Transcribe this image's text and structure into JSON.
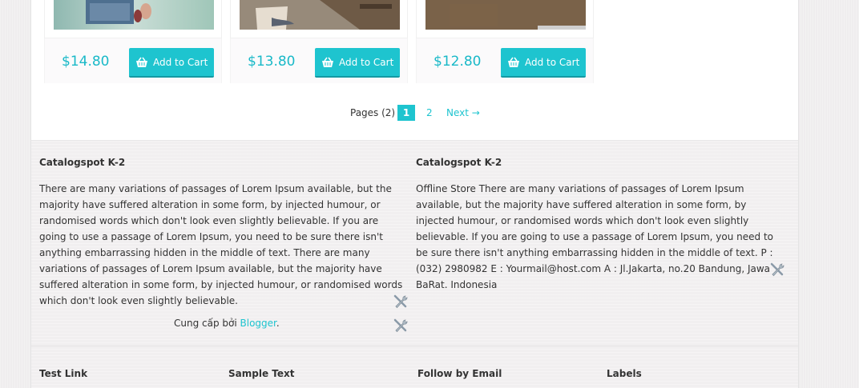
{
  "products": [
    {
      "price": "$14.80",
      "button_label": "Add to Cart"
    },
    {
      "price": "$13.80",
      "button_label": "Add to Cart"
    },
    {
      "price": "$12.80",
      "button_label": "Add to Cart"
    }
  ],
  "pagination": {
    "label": "Pages (2)",
    "current": "1",
    "page2": "2",
    "next": "Next →"
  },
  "footer": {
    "left": {
      "title": "Catalogspot K-2",
      "text": "There are many variations of passages of Lorem Ipsum available, but the majority have suffered alteration in some form, by injected humour, or randomised words which don't look even slightly believable. If you are going to use a passage of Lorem Ipsum, you need to be sure there isn't anything embarrassing hidden in the middle of text. There are many variations of passages of Lorem Ipsum available, but the majority have suffered alteration in some form, by injected humour, or randomised words which don't look even slightly believable."
    },
    "right": {
      "title": "Catalogspot K-2",
      "text": "Offline Store There are many variations of passages of Lorem Ipsum available, but the majority have suffered alteration in some form, by injected humour, or randomised words which don't look even slightly believable. If you are going to use a passage of Lorem Ipsum, you need to be sure there isn't anything embarrassing hidden in the middle of text. P : (032) 2980982 E : Yourmail@host.com A : Jl.Jakarta, no.20 Bandung, Jawa BaRat. Indonesia"
    },
    "powered_prefix": "Cung cấp bởi ",
    "powered_link": "Blogger",
    "powered_suffix": ".",
    "widgets": [
      "Test Link",
      "Sample Text",
      "Follow by Email",
      "Labels"
    ]
  },
  "colors": {
    "accent": "#1ec4cf",
    "price": "#19b9c8"
  },
  "icons": {
    "cart": "basket-icon",
    "edit": "wrench-screwdriver-icon"
  }
}
